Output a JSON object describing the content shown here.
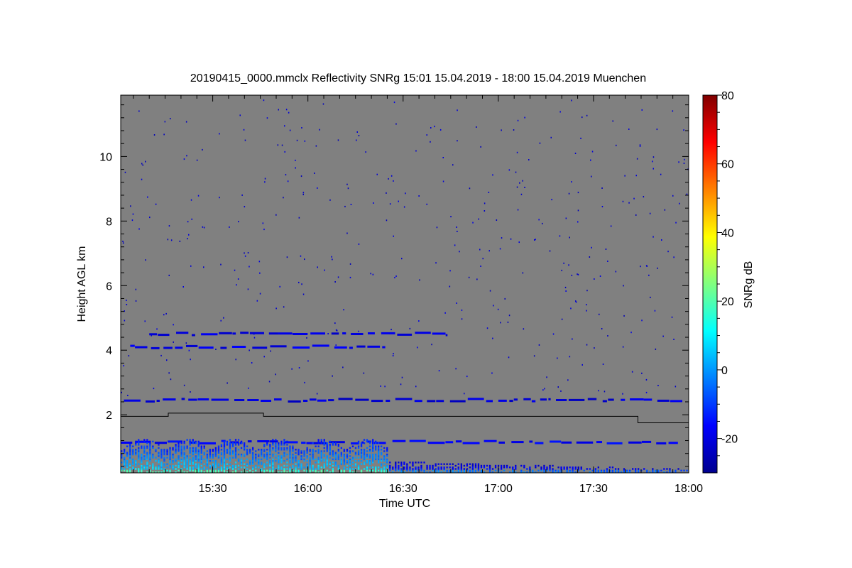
{
  "chart_data": {
    "type": "heatmap",
    "title": "20190415_0000.mmclx Reflectivity SNRg   15:01 15.04.2019 - 18:00 15.04.2019 Muenchen",
    "xlabel": "Time UTC",
    "ylabel": "Height AGL km",
    "colorbar_label": "SNRg dB",
    "x_ticks": [
      "15:30",
      "16:00",
      "16:30",
      "17:00",
      "17:30",
      "18:00"
    ],
    "x_tick_minutes": [
      930,
      960,
      990,
      1020,
      1050,
      1080
    ],
    "xlim_minutes": [
      901,
      1080
    ],
    "y_ticks": [
      2,
      4,
      6,
      8,
      10
    ],
    "ylim": [
      0.2,
      11.9
    ],
    "colorbar_ticks": [
      -20,
      0,
      20,
      40,
      60,
      80
    ],
    "colorbar_range": [
      -30,
      80
    ],
    "background_color": "#808080",
    "colormap": [
      "#00008f",
      "#0000ff",
      "#0080ff",
      "#00ffff",
      "#80ff80",
      "#ffff00",
      "#ff8000",
      "#ff0000",
      "#800000"
    ],
    "cloud_base_line": {
      "color": "#000000",
      "points": [
        [
          901,
          1.95
        ],
        [
          916,
          1.95
        ],
        [
          916,
          2.05
        ],
        [
          946,
          2.05
        ],
        [
          946,
          1.95
        ],
        [
          1064,
          1.95
        ],
        [
          1064,
          1.75
        ],
        [
          1080,
          1.75
        ]
      ]
    },
    "echo_layers": [
      {
        "name_hint": "layer_4.1km",
        "height": 4.1,
        "start": 904,
        "end": 985,
        "snr": -22
      },
      {
        "name_hint": "layer_4.5km",
        "height": 4.5,
        "start": 910,
        "end": 1004,
        "snr": -23
      },
      {
        "name_hint": "layer_2.4km",
        "height": 2.45,
        "start": 902,
        "end": 1078,
        "snr": -24
      },
      {
        "name_hint": "layer_1.15km",
        "height": 1.15,
        "start": 901,
        "end": 1078,
        "snr": -20
      },
      {
        "name_hint": "near_surface",
        "height": 0.6,
        "start": 901,
        "end": 1080,
        "snr": 0
      }
    ]
  }
}
